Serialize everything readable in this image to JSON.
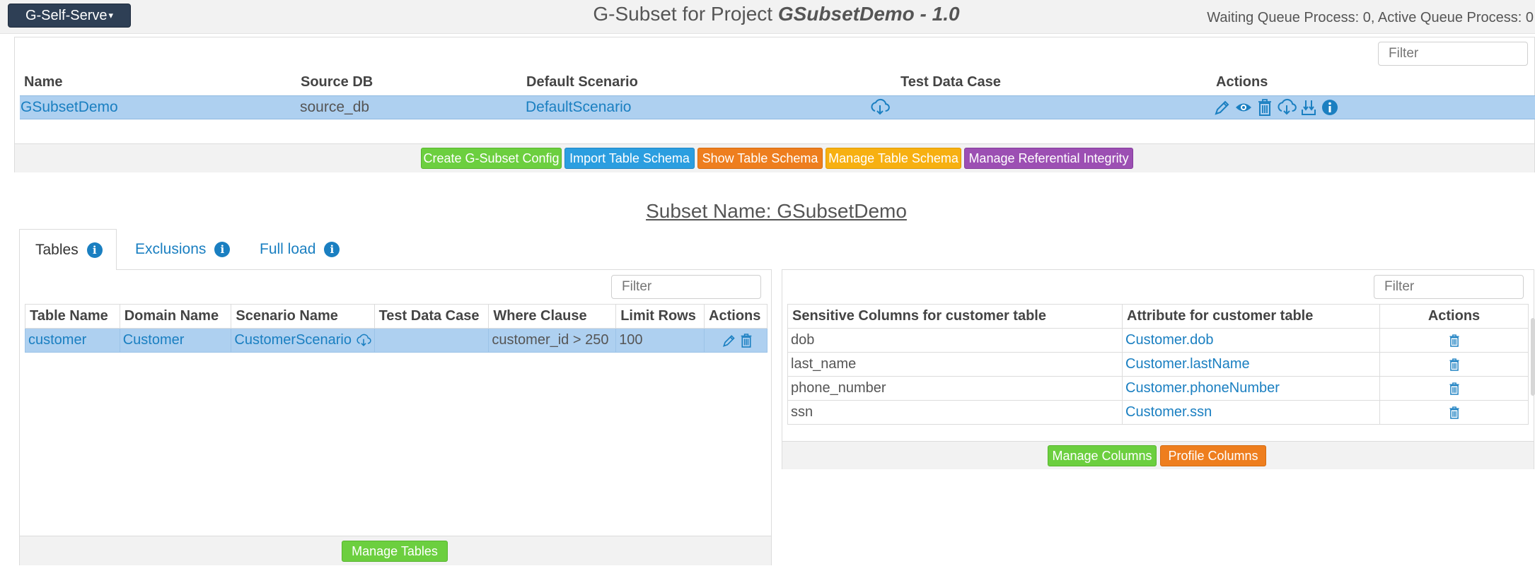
{
  "header": {
    "app_menu": "G-Self-Serve",
    "title_prefix": "G-Subset for Project ",
    "title_project": "GSubsetDemo - 1.0",
    "queue_status": "Waiting Queue Process: 0, Active Queue Process: 0"
  },
  "project_table": {
    "filter_placeholder": "Filter",
    "columns": [
      "Name",
      "Source DB",
      "Default Scenario",
      "Test Data Case",
      "Actions"
    ],
    "row": {
      "name": "GSubsetDemo",
      "source_db": "source_db",
      "default_scenario": "DefaultScenario",
      "test_data_case_icon": "cloud-download-icon",
      "action_icons": [
        "edit-icon",
        "view-icon",
        "delete-icon",
        "cloud-download-icon",
        "download-icon",
        "info-icon"
      ]
    }
  },
  "project_buttons": {
    "create_config": "Create G-Subset Config",
    "import_schema": "Import Table Schema",
    "show_schema": "Show Table Schema",
    "manage_schema": "Manage Table Schema",
    "manage_integrity": "Manage Referential Integrity"
  },
  "subset_title": "Subset Name: GSubsetDemo",
  "tabs": [
    {
      "label": "Tables",
      "active": true
    },
    {
      "label": "Exclusions",
      "active": false
    },
    {
      "label": "Full load",
      "active": false
    }
  ],
  "tables_panel": {
    "filter_placeholder": "Filter",
    "columns": [
      "Table Name",
      "Domain Name",
      "Scenario Name",
      "Test Data Case",
      "Where Clause",
      "Limit Rows",
      "Actions"
    ],
    "rows": [
      {
        "table_name": "customer",
        "domain_name": "Customer",
        "scenario_name": "CustomerScenario",
        "test_data_case": "",
        "where_clause": "customer_id > 250",
        "limit_rows": "100"
      }
    ],
    "manage_button": "Manage Tables"
  },
  "columns_panel": {
    "filter_placeholder": "Filter",
    "columns": [
      "Sensitive Columns for customer table",
      "Attribute for customer table",
      "Actions"
    ],
    "rows": [
      {
        "column": "dob",
        "attribute": "Customer.dob"
      },
      {
        "column": "last_name",
        "attribute": "Customer.lastName"
      },
      {
        "column": "phone_number",
        "attribute": "Customer.phoneNumber"
      },
      {
        "column": "ssn",
        "attribute": "Customer.ssn"
      }
    ],
    "manage_button": "Manage Columns",
    "profile_button": "Profile Columns"
  },
  "colors": {
    "header_dark": "#2e3f55",
    "link": "#1a7fc1",
    "selected_row": "#aed0f0",
    "green": "#6ccf3f",
    "blue": "#2b9ee0",
    "orange": "#ee7e1e",
    "yellow": "#f7b011",
    "purple": "#9c4fb3"
  }
}
